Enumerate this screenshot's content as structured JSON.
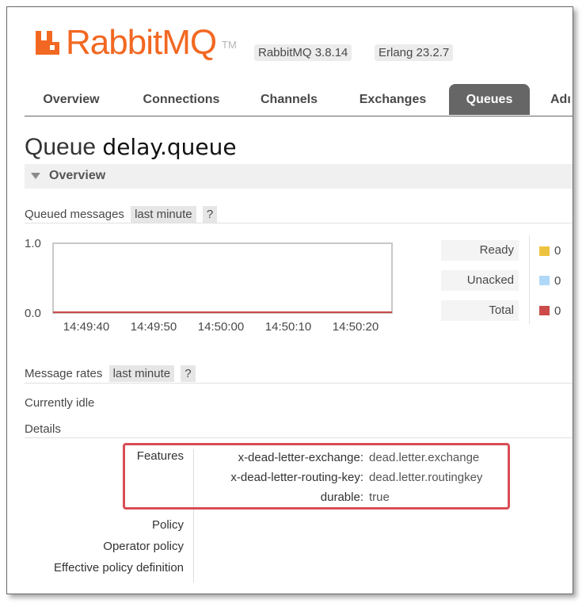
{
  "header": {
    "logo_text": "RabbitMQ",
    "logo_tm": "TM",
    "version": "RabbitMQ 3.8.14",
    "erlang": "Erlang 23.2.7",
    "brand_color": "#f26822"
  },
  "tabs": [
    {
      "label": "Overview"
    },
    {
      "label": "Connections"
    },
    {
      "label": "Channels"
    },
    {
      "label": "Exchanges"
    },
    {
      "label": "Queues",
      "active": true
    },
    {
      "label": "Adı"
    }
  ],
  "page": {
    "title_prefix": "Queue",
    "queue_name": "delay.queue",
    "section": "Overview"
  },
  "queued_messages": {
    "label": "Queued messages",
    "range": "last minute",
    "help": "?"
  },
  "chart_data": {
    "type": "line",
    "x": [
      "14:49:40",
      "14:49:50",
      "14:50:00",
      "14:50:10",
      "14:50:20"
    ],
    "ylim": [
      0.0,
      1.0
    ],
    "y_ticks": [
      "1.0",
      "0.0"
    ],
    "series": [
      {
        "name": "Ready",
        "color": "#edc240",
        "values": [
          0,
          0,
          0,
          0,
          0
        ]
      },
      {
        "name": "Unacked",
        "color": "#afd8f8",
        "values": [
          0,
          0,
          0,
          0,
          0
        ]
      },
      {
        "name": "Total",
        "color": "#cb4b4b",
        "values": [
          0,
          0,
          0,
          0,
          0
        ]
      }
    ]
  },
  "legend": [
    {
      "name": "Ready",
      "value": "0",
      "color": "#edc240"
    },
    {
      "name": "Unacked",
      "value": "0",
      "color": "#afd8f8"
    },
    {
      "name": "Total",
      "value": "0",
      "color": "#cb4b4b"
    }
  ],
  "message_rates": {
    "label": "Message rates",
    "range": "last minute",
    "help": "?",
    "status": "Currently idle"
  },
  "details": {
    "label": "Details",
    "features_label": "Features",
    "features": [
      {
        "key": "x-dead-letter-exchange:",
        "value": "dead.letter.exchange"
      },
      {
        "key": "x-dead-letter-routing-key:",
        "value": "dead.letter.routingkey"
      },
      {
        "key": "durable:",
        "value": "true"
      }
    ],
    "policy": "Policy",
    "operator_policy": "Operator policy",
    "effective_policy": "Effective policy definition"
  }
}
